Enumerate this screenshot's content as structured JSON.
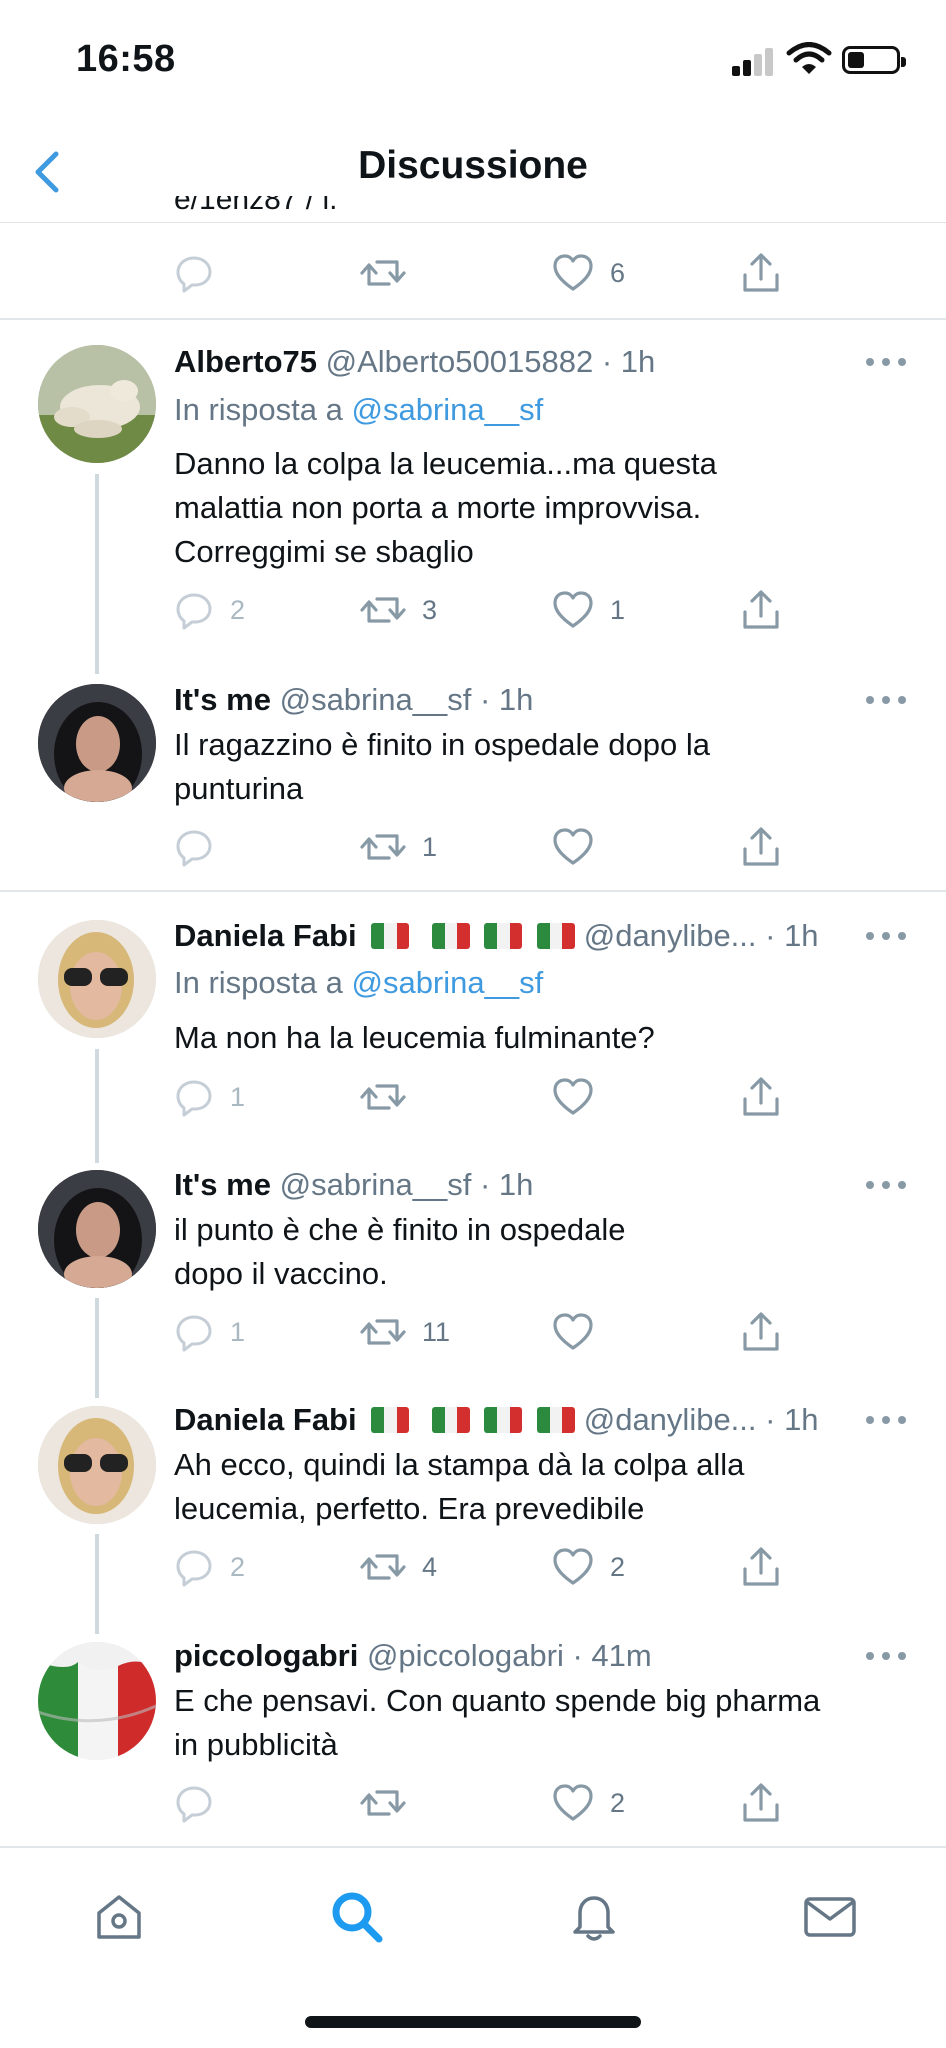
{
  "status_bar": {
    "time": "16:58"
  },
  "nav": {
    "title": "Discussione"
  },
  "partial_tweet": {
    "text_cut": "e/1ehz87 / i.",
    "likes": "6"
  },
  "tweets": [
    {
      "name": "Alberto75",
      "handle": "@Alberto50015882 · 1h",
      "reply_prefix": "In risposta a ",
      "reply_to": "@sabrina__sf",
      "text_lines": [
        "Danno la colpa la leucemia...ma questa",
        "malattia non porta a morte improvvisa.",
        "Correggimi se sbaglio"
      ],
      "replies": "2",
      "retweets": "3",
      "likes": "1"
    },
    {
      "name": "It's me",
      "handle": "@sabrina__sf · 1h",
      "text_lines": [
        "Il ragazzino è finito in ospedale dopo la",
        "punturina"
      ],
      "replies": "",
      "retweets": "1",
      "likes": ""
    },
    {
      "name": "Daniela Fabi",
      "handle": "@danylibe... · 1h",
      "reply_prefix": "In risposta a ",
      "reply_to": "@sabrina__sf",
      "text_lines": [
        "Ma non ha la leucemia fulminante?"
      ],
      "replies": "1",
      "retweets": "",
      "likes": ""
    },
    {
      "name": "It's me",
      "handle": "@sabrina__sf · 1h",
      "text_lines": [
        "il punto è che è finito in ospedale",
        "dopo il vaccino."
      ],
      "replies": "1",
      "retweets": "11",
      "likes": ""
    },
    {
      "name": "Daniela Fabi",
      "handle": "@danylibe... · 1h",
      "text_lines": [
        "Ah ecco, quindi la stampa dà la colpa alla",
        "leucemia, perfetto. Era prevedibile"
      ],
      "replies": "2",
      "retweets": "4",
      "likes": "2"
    },
    {
      "name": "piccologabri",
      "handle": "@piccologabri · 41m",
      "text_lines": [
        "E che pensavi. Con quanto spende big pharma",
        "in pubblicità"
      ],
      "replies": "",
      "retweets": "",
      "likes": "2"
    }
  ],
  "icons": {
    "reply": "reply-icon",
    "retweet": "retweet-icon",
    "like": "heart-icon",
    "share": "share-icon",
    "home": "home-icon",
    "search": "search-icon",
    "notifications": "bell-icon",
    "messages": "mail-icon"
  },
  "colors": {
    "accent": "#1d9bf0",
    "mention": "#3f9ae0",
    "muted": "#657786",
    "icon": "#8899a6"
  }
}
